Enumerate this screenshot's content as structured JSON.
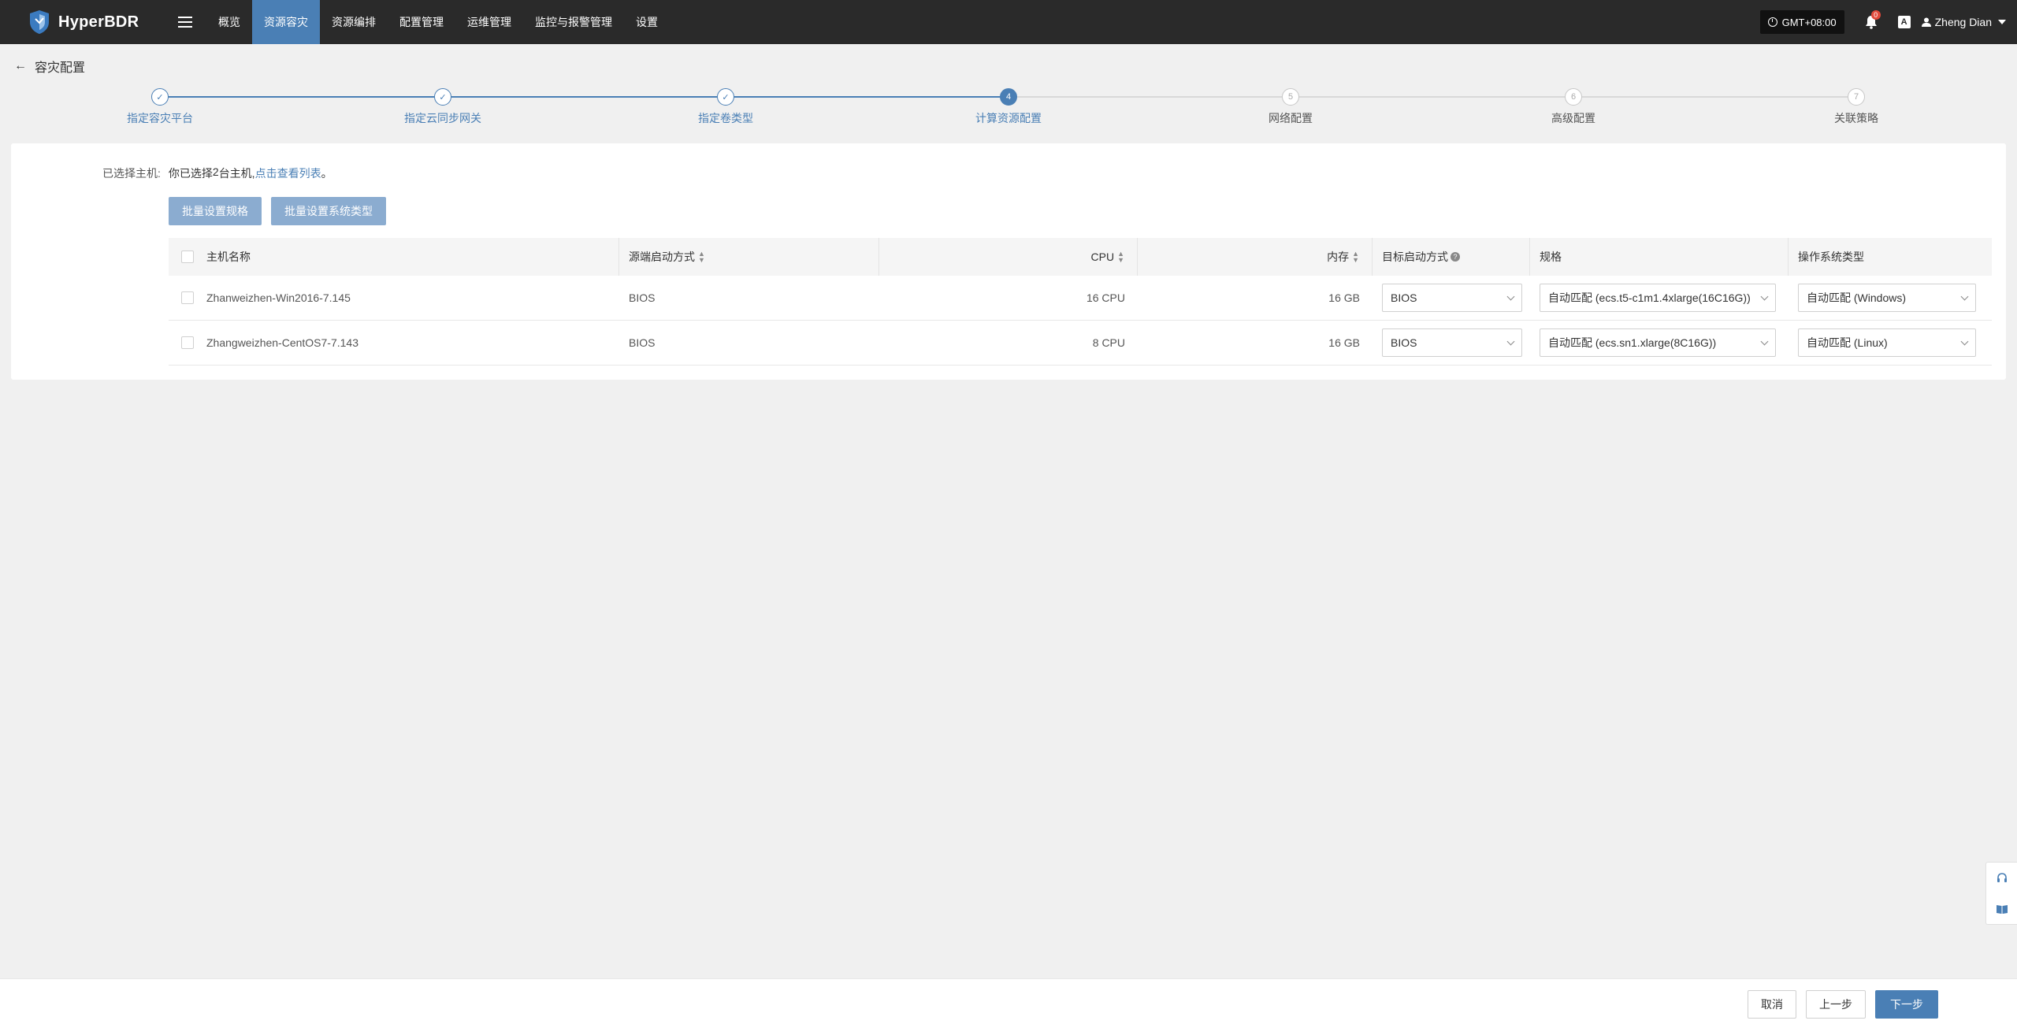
{
  "app": {
    "logo_text": "HyperBDR",
    "menu": [
      {
        "label": "概览"
      },
      {
        "label": "资源容灾"
      },
      {
        "label": "资源编排"
      },
      {
        "label": "配置管理"
      },
      {
        "label": "运维管理"
      },
      {
        "label": "监控与报警管理"
      },
      {
        "label": "设置"
      }
    ],
    "active_menu": "资源容灾",
    "timezone": "GMT+08:00",
    "notification_count": "0",
    "lang_icon_label": "A",
    "user_name": "Zheng Dian"
  },
  "page": {
    "title": "容灾配置"
  },
  "steps": [
    {
      "num": "1",
      "label": "指定容灾平台",
      "state": "done"
    },
    {
      "num": "2",
      "label": "指定云同步网关",
      "state": "done"
    },
    {
      "num": "3",
      "label": "指定卷类型",
      "state": "done"
    },
    {
      "num": "4",
      "label": "计算资源配置",
      "state": "current"
    },
    {
      "num": "5",
      "label": "网络配置",
      "state": "todo"
    },
    {
      "num": "6",
      "label": "高级配置",
      "state": "todo"
    },
    {
      "num": "7",
      "label": "关联策略",
      "state": "todo"
    }
  ],
  "selection": {
    "label": "已选择主机:",
    "text_before": "你已选择",
    "count": "2",
    "text_after": "台主机,",
    "link": "点击查看列表",
    "end": "。"
  },
  "batch_buttons": {
    "spec": "批量设置规格",
    "os": "批量设置系统类型"
  },
  "table": {
    "headers": {
      "name": "主机名称",
      "source_boot": "源端启动方式",
      "cpu": "CPU",
      "memory": "内存",
      "target_boot": "目标启动方式",
      "spec": "规格",
      "os": "操作系统类型"
    },
    "rows": [
      {
        "name": "Zhanweizhen-Win2016-7.145",
        "source_boot": "BIOS",
        "cpu": "16 CPU",
        "memory": "16 GB",
        "target_boot": "BIOS",
        "spec": "自动匹配 (ecs.t5-c1m1.4xlarge(16C16G))",
        "os": "自动匹配 (Windows)"
      },
      {
        "name": "Zhangweizhen-CentOS7-7.143",
        "source_boot": "BIOS",
        "cpu": "8 CPU",
        "memory": "16 GB",
        "target_boot": "BIOS",
        "spec": "自动匹配 (ecs.sn1.xlarge(8C16G))",
        "os": "自动匹配 (Linux)"
      }
    ]
  },
  "footer": {
    "cancel": "取消",
    "prev": "上一步",
    "next": "下一步"
  },
  "colors": {
    "primary": "#4a7fb5",
    "nav_bg": "#2a2a2a",
    "batch_btn": "#8bacd0",
    "badge": "#e24a3b"
  }
}
